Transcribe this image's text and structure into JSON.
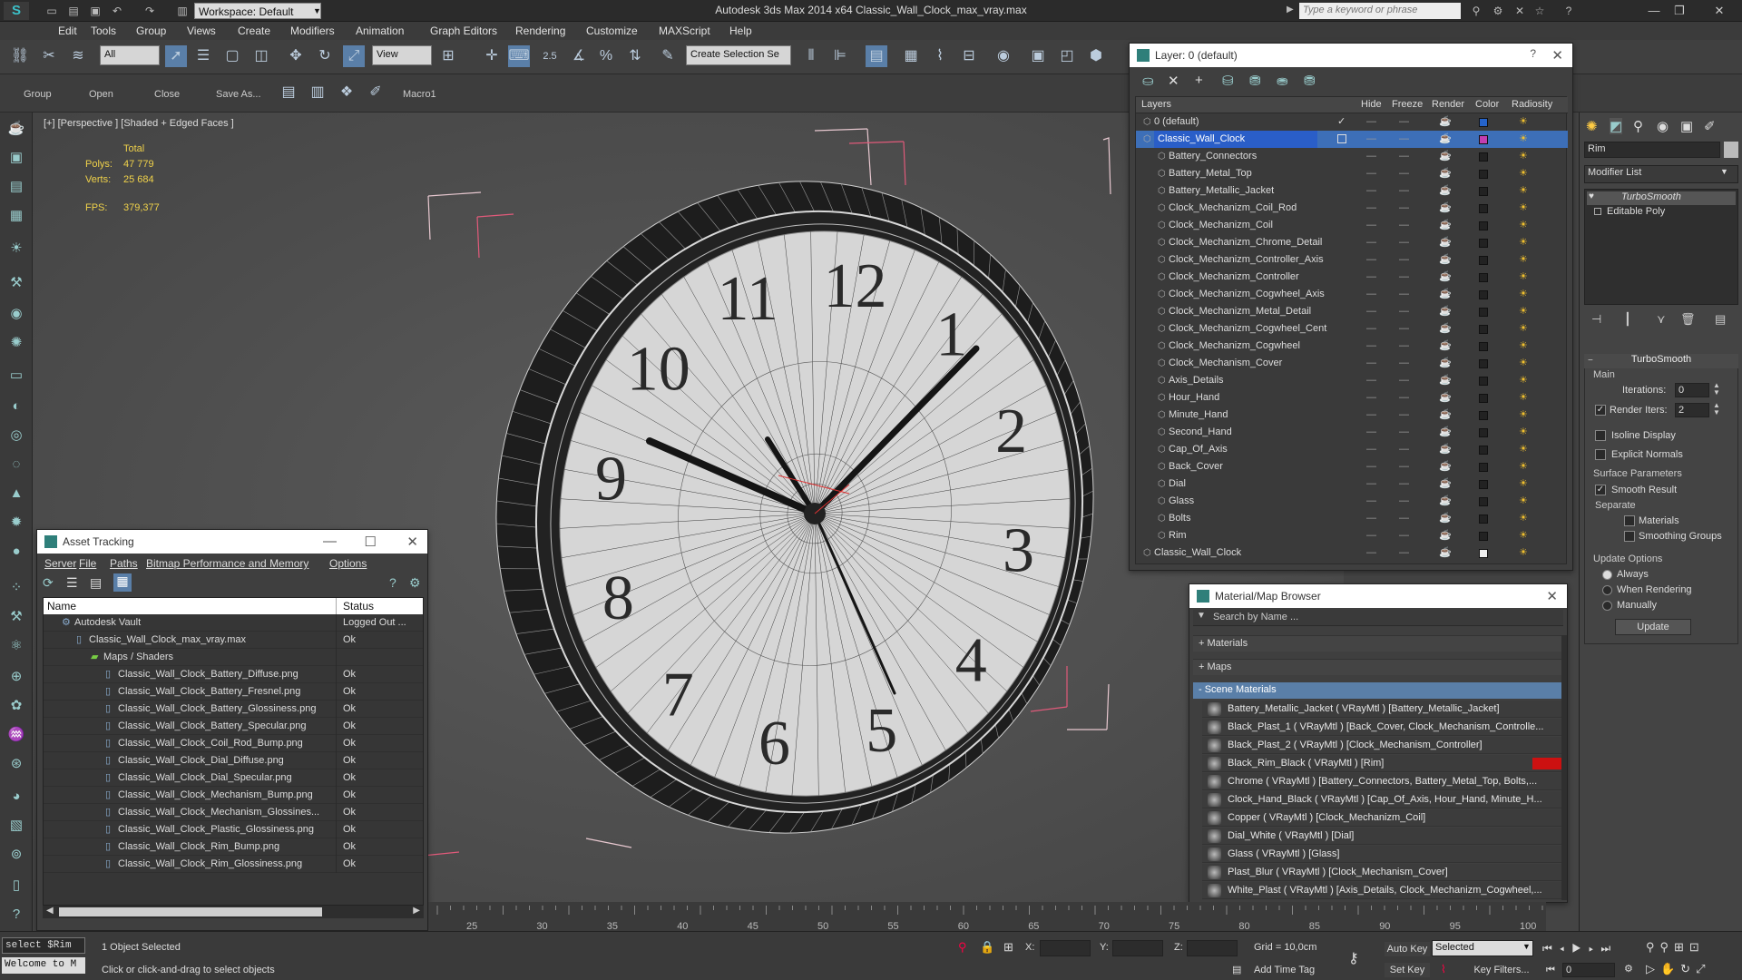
{
  "app": {
    "title": "Autodesk 3ds Max  2014 x64     Classic_Wall_Clock_max_vray.max",
    "workspace": "Workspace: Default",
    "search_placeholder": "Type a keyword or phrase"
  },
  "menu": [
    "Edit",
    "Tools",
    "Group",
    "Views",
    "Create",
    "Modifiers",
    "Animation",
    "Graph Editors",
    "Rendering",
    "Customize",
    "MAXScript",
    "Help"
  ],
  "toolbar": {
    "filter": "All",
    "ref_coord": "View",
    "snap_value": "2.5",
    "selection_set": "Create Selection Se"
  },
  "toolbar2": [
    "Group",
    "Open",
    "Close",
    "Save As...",
    "Macro1"
  ],
  "viewport": {
    "label": "[+] [Perspective ] [Shaded + Edged Faces ]",
    "stats": {
      "total_label": "Total",
      "polys_label": "Polys:",
      "polys": "47 779",
      "verts_label": "Verts:",
      "verts": "25 684",
      "fps_label": "FPS:",
      "fps": "379,377"
    },
    "clock_numbers": [
      "12",
      "1",
      "2",
      "3",
      "4",
      "5",
      "6",
      "7",
      "8",
      "9",
      "10",
      "11"
    ]
  },
  "layer_panel": {
    "title": "Layer: 0 (default)",
    "columns": [
      "Layers",
      "Hide",
      "Freeze",
      "Render",
      "Color",
      "Radiosity"
    ],
    "rows": [
      {
        "name": "0 (default)",
        "color": "#2563c9"
      },
      {
        "name": "Classic_Wall_Clock",
        "color": "#c23eb0"
      },
      {
        "name": "Battery_Connectors",
        "color": "#222222"
      },
      {
        "name": "Battery_Metal_Top",
        "color": "#222222"
      },
      {
        "name": "Battery_Metallic_Jacket",
        "color": "#222222"
      },
      {
        "name": "Clock_Mechanizm_Coil_Rod",
        "color": "#222222"
      },
      {
        "name": "Clock_Mechanizm_Coil",
        "color": "#222222"
      },
      {
        "name": "Clock_Mechanizm_Chrome_Detail",
        "color": "#222222"
      },
      {
        "name": "Clock_Mechanizm_Controller_Axis",
        "color": "#222222"
      },
      {
        "name": "Clock_Mechanizm_Controller",
        "color": "#222222"
      },
      {
        "name": "Clock_Mechanizm_Cogwheel_Axis",
        "color": "#222222"
      },
      {
        "name": "Clock_Mechanizm_Metal_Detail",
        "color": "#222222"
      },
      {
        "name": "Clock_Mechanizm_Cogwheel_Cent",
        "color": "#222222"
      },
      {
        "name": "Clock_Mechanizm_Cogwheel",
        "color": "#222222"
      },
      {
        "name": "Clock_Mechanism_Cover",
        "color": "#222222"
      },
      {
        "name": "Axis_Details",
        "color": "#222222"
      },
      {
        "name": "Hour_Hand",
        "color": "#222222"
      },
      {
        "name": "Minute_Hand",
        "color": "#222222"
      },
      {
        "name": "Second_Hand",
        "color": "#222222"
      },
      {
        "name": "Cap_Of_Axis",
        "color": "#222222"
      },
      {
        "name": "Back_Cover",
        "color": "#222222"
      },
      {
        "name": "Dial",
        "color": "#222222"
      },
      {
        "name": "Glass",
        "color": "#222222"
      },
      {
        "name": "Bolts",
        "color": "#222222"
      },
      {
        "name": "Rim",
        "color": "#222222"
      },
      {
        "name": "Classic_Wall_Clock",
        "color": "#eeeeee"
      }
    ]
  },
  "asset_panel": {
    "title": "Asset Tracking",
    "menu": [
      "Server",
      "File",
      "Paths",
      "Bitmap Performance and Memory",
      "Options"
    ],
    "columns": [
      "Name",
      "Status"
    ],
    "rows": [
      {
        "name": "Autodesk Vault",
        "status": "Logged Out ..."
      },
      {
        "name": "Classic_Wall_Clock_max_vray.max",
        "status": "Ok"
      },
      {
        "name": "Maps / Shaders",
        "status": ""
      },
      {
        "name": "Classic_Wall_Clock_Battery_Diffuse.png",
        "status": "Ok"
      },
      {
        "name": "Classic_Wall_Clock_Battery_Fresnel.png",
        "status": "Ok"
      },
      {
        "name": "Classic_Wall_Clock_Battery_Glossiness.png",
        "status": "Ok"
      },
      {
        "name": "Classic_Wall_Clock_Battery_Specular.png",
        "status": "Ok"
      },
      {
        "name": "Classic_Wall_Clock_Coil_Rod_Bump.png",
        "status": "Ok"
      },
      {
        "name": "Classic_Wall_Clock_Dial_Diffuse.png",
        "status": "Ok"
      },
      {
        "name": "Classic_Wall_Clock_Dial_Specular.png",
        "status": "Ok"
      },
      {
        "name": "Classic_Wall_Clock_Mechanism_Bump.png",
        "status": "Ok"
      },
      {
        "name": "Classic_Wall_Clock_Mechanism_Glossines...",
        "status": "Ok"
      },
      {
        "name": "Classic_Wall_Clock_Plastic_Glossiness.png",
        "status": "Ok"
      },
      {
        "name": "Classic_Wall_Clock_Rim_Bump.png",
        "status": "Ok"
      },
      {
        "name": "Classic_Wall_Clock_Rim_Glossiness.png",
        "status": "Ok"
      }
    ]
  },
  "material_panel": {
    "title": "Material/Map Browser",
    "search_placeholder": "Search by Name ...",
    "groups": [
      "+ Materials",
      "+ Maps",
      "- Scene Materials"
    ],
    "rows": [
      "Battery_Metallic_Jacket  ( VRayMtl ) [Battery_Metallic_Jacket]",
      "Black_Plast_1  ( VRayMtl ) [Back_Cover, Clock_Mechanism_Controlle...",
      "Black_Plast_2  ( VRayMtl ) [Clock_Mechanism_Controller]",
      "Black_Rim_Black  ( VRayMtl ) [Rim]",
      "Chrome  ( VRayMtl ) [Battery_Connectors, Battery_Metal_Top, Bolts,...",
      "Clock_Hand_Black  ( VRayMtl ) [Cap_Of_Axis, Hour_Hand, Minute_H...",
      "Copper  ( VRayMtl ) [Clock_Mechanizm_Coil]",
      "Dial_White  ( VRayMtl ) [Dial]",
      "Glass  ( VRayMtl ) [Glass]",
      "Plast_Blur  ( VRayMtl ) [Clock_Mechanism_Cover]",
      "White_Plast  ( VRayMtl ) [Axis_Details, Clock_Mechanizm_Cogwheel,..."
    ]
  },
  "modify_panel": {
    "object_name": "Rim",
    "modifier_list": "Modifier List",
    "stack": [
      "TurboSmooth",
      "Editable Poly"
    ],
    "rollout_title": "TurboSmooth",
    "main_label": "Main",
    "iterations_label": "Iterations:",
    "iterations": "0",
    "render_iters_label": "Render Iters:",
    "render_iters": "2",
    "isoline": "Isoline Display",
    "explicit_normals": "Explicit Normals",
    "surface_params": "Surface Parameters",
    "smooth_result": "Smooth Result",
    "separate": "Separate",
    "materials": "Materials",
    "smoothing_groups": "Smoothing Groups",
    "update_options": "Update Options",
    "always": "Always",
    "when_rendering": "When Rendering",
    "manually": "Manually",
    "update_button": "Update"
  },
  "timeline": {
    "ticks": [
      "25",
      "30",
      "35",
      "40",
      "45",
      "50",
      "55",
      "60",
      "65",
      "70",
      "75",
      "80",
      "85",
      "90",
      "95",
      "100"
    ]
  },
  "status": {
    "script1": "select $Rim",
    "script2": "Welcome to M",
    "selected": "1 Object Selected",
    "prompt": "Click or click-and-drag to select objects",
    "x_label": "X:",
    "y_label": "Y:",
    "z_label": "Z:",
    "grid": "Grid = 10,0cm",
    "add_time_tag": "Add Time Tag",
    "auto_key": "Auto Key",
    "selected_mode": "Selected",
    "set_key": "Set Key",
    "key_filters": "Key Filters...",
    "frame": "0"
  }
}
